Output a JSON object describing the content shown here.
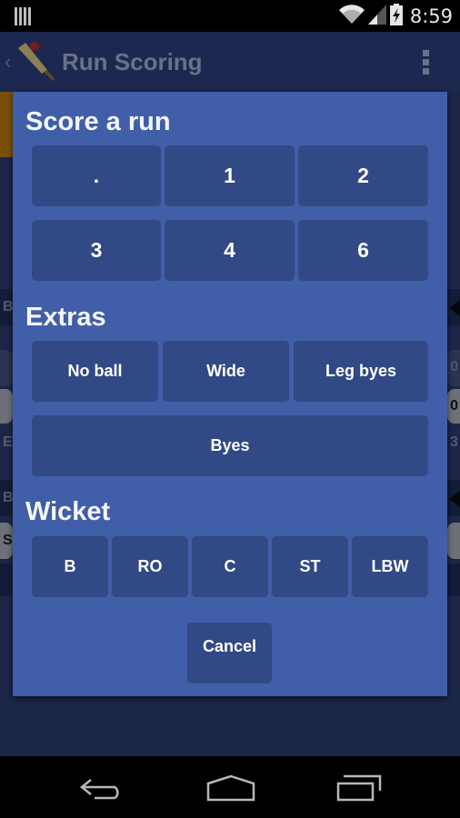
{
  "status_bar": {
    "time": "8:59",
    "icons": [
      "notification-bars-icon",
      "wifi-icon",
      "cell-signal-icon",
      "battery-charging-icon"
    ]
  },
  "app_bar": {
    "title": "Run Scoring",
    "icons": [
      "back-chevron-icon",
      "cricket-bat-icon",
      "overflow-menu-icon"
    ]
  },
  "background": {
    "partial_letters": [
      "B",
      "E",
      "B",
      "S"
    ],
    "partial_digits": [
      "0",
      "0",
      "3"
    ]
  },
  "dialog": {
    "score_section": {
      "title": "Score a run",
      "buttons": [
        ".",
        "1",
        "2",
        "3",
        "4",
        "6"
      ]
    },
    "extras_section": {
      "title": "Extras",
      "buttons": [
        "No ball",
        "Wide",
        "Leg byes",
        "Byes"
      ]
    },
    "wicket_section": {
      "title": "Wicket",
      "buttons": [
        "B",
        "RO",
        "C",
        "ST",
        "LBW"
      ]
    },
    "cancel_label": "Cancel"
  },
  "nav_bar": {
    "icons": [
      "back-icon",
      "home-icon",
      "recent-apps-icon"
    ]
  },
  "colors": {
    "dialog_bg": "#415ea8",
    "button_bg": "#314985",
    "app_bg": "#1b2649",
    "text": "#ffffff"
  }
}
